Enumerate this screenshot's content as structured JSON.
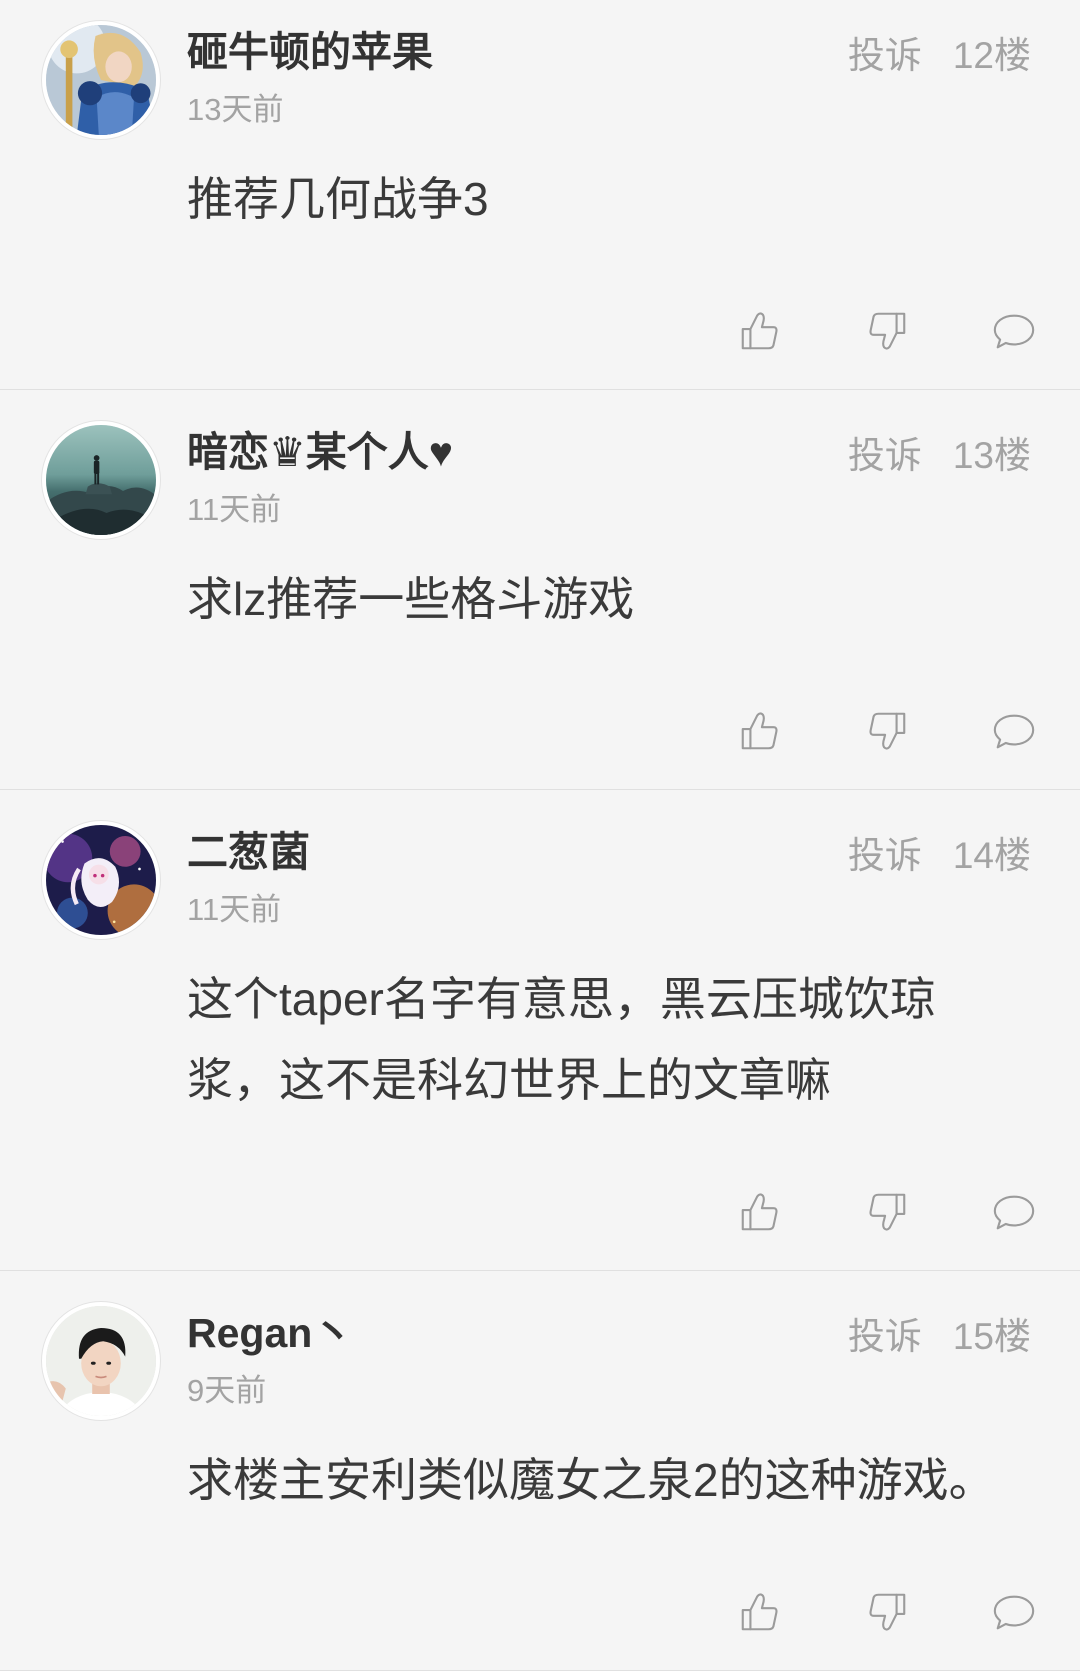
{
  "colors": {
    "bg": "#f5f5f5",
    "text": "#333333",
    "body_text": "#3a3a3a",
    "secondary": "#a3a3a3",
    "divider": "#e0e0e0",
    "icon": "#9b9b9b"
  },
  "comments": [
    {
      "username": "砸牛顿的苹果",
      "time": "13天前",
      "content": "推荐几何战争3",
      "report_label": "投诉",
      "floor": "12楼"
    },
    {
      "username": "暗恋♛某个人♥",
      "time": "11天前",
      "content": "求lz推荐一些格斗游戏",
      "report_label": "投诉",
      "floor": "13楼"
    },
    {
      "username": "二葱菌",
      "time": "11天前",
      "content": "这个taper名字有意思，黑云压城饮琼浆，这不是科幻世界上的文章嘛",
      "report_label": "投诉",
      "floor": "14楼"
    },
    {
      "username": "Regan丶",
      "time": "9天前",
      "content": "求楼主安利类似魔女之泉2的这种游戏。",
      "report_label": "投诉",
      "floor": "15楼"
    }
  ],
  "actions": {
    "like_icon": "thumbs-up-icon",
    "dislike_icon": "thumbs-down-icon",
    "reply_icon": "comment-bubble-icon"
  }
}
